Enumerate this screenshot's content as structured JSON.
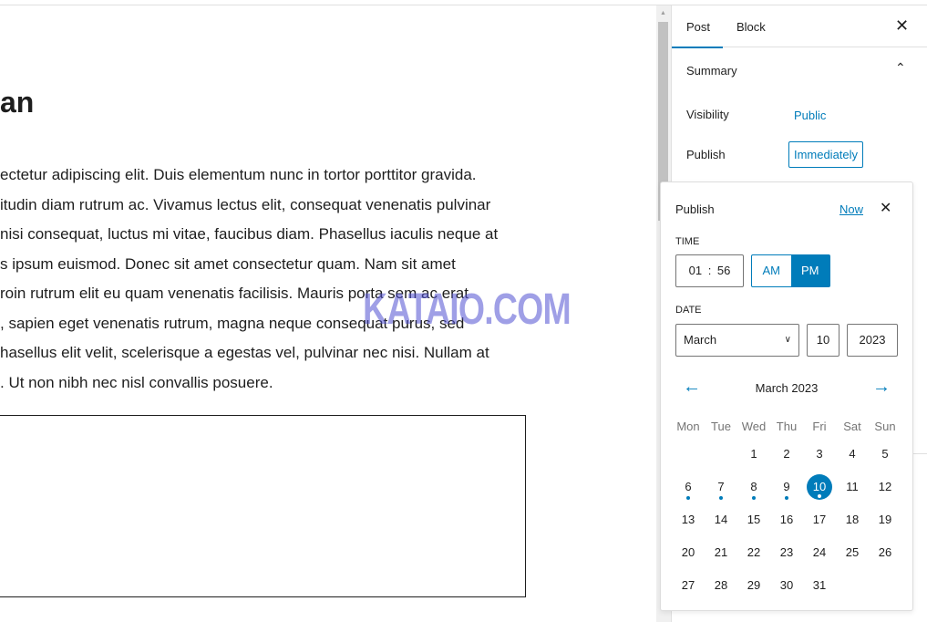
{
  "editor": {
    "title_fragment": "an",
    "lines": [
      "ectetur adipiscing elit. Duis elementum nunc in tortor porttitor gravida.",
      "itudin diam rutrum ac. Vivamus lectus elit, consequat venenatis pulvinar",
      "nisi consequat, luctus mi vitae, faucibus diam. Phasellus iaculis neque at",
      "s ipsum euismod. Donec sit amet consectetur quam. Nam sit amet",
      "roin rutrum elit eu quam venenatis facilisis. Mauris porta sem ac erat",
      ", sapien eget venenatis rutrum, magna neque consequat purus, sed",
      "hasellus elit velit, scelerisque a egestas vel, pulvinar nec nisi. Nullam at",
      ". Ut non nibh nec nisl convallis posuere."
    ]
  },
  "watermark": "KATAIO.COM",
  "sidebar": {
    "tabs": [
      {
        "label": "Post",
        "active": true
      },
      {
        "label": "Block"
      }
    ],
    "summary": "Summary",
    "visibility_label": "Visibility",
    "visibility_value": "Public",
    "publish_label": "Publish",
    "publish_value": "Immediately"
  },
  "popover": {
    "title": "Publish",
    "now": "Now",
    "time_label": "TIME",
    "hour": "01",
    "minute": "56",
    "am": "AM",
    "pm": "PM",
    "pm_selected": true,
    "date_label": "DATE",
    "month": "March",
    "day": "10",
    "year": "2023",
    "calendar_title": "March 2023",
    "weekdays": [
      "Mon",
      "Tue",
      "Wed",
      "Thu",
      "Fri",
      "Sat",
      "Sun"
    ],
    "first_weekday_index": 2,
    "days_in_month": 31,
    "selected_day": 10,
    "dotted_days": [
      6,
      7,
      8,
      9,
      10
    ]
  },
  "colors": {
    "accent": "#007cba"
  }
}
